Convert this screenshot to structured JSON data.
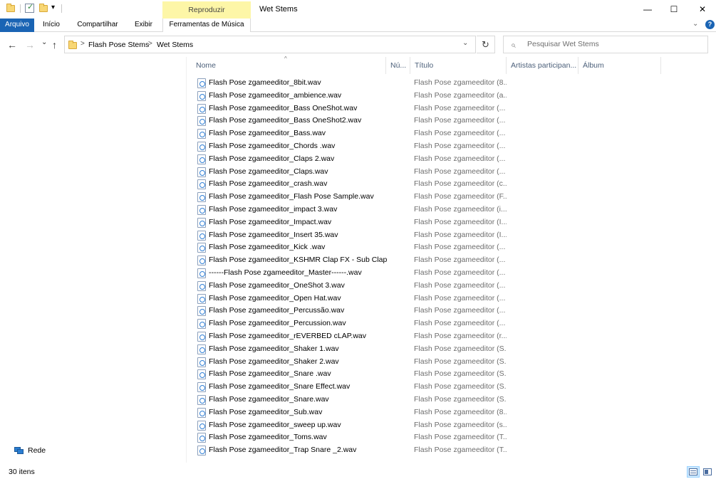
{
  "window": {
    "title": "Wet Stems",
    "minimize_glyph": "—",
    "maximize_glyph": "☐",
    "close_glyph": "✕"
  },
  "quick_access": {
    "dropdown_glyph": "▾"
  },
  "ribbon": {
    "context_group": "Reproduzir",
    "tabs": [
      {
        "label": "Arquivo"
      },
      {
        "label": "Início"
      },
      {
        "label": "Compartilhar"
      },
      {
        "label": "Exibir"
      },
      {
        "label": "Ferramentas de Música"
      }
    ],
    "expand_glyph": "⌄",
    "help_glyph": "?"
  },
  "navigation": {
    "back_glyph": "←",
    "forward_glyph": "→",
    "recent_glyph": "⌄",
    "up_glyph": "↑",
    "breadcrumb": [
      "Flash Pose Stems",
      "Wet Stems"
    ],
    "crumb_sep": ">",
    "address_dropdown_glyph": "⌄",
    "refresh_glyph": "↻"
  },
  "search": {
    "placeholder": "Pesquisar Wet Stems",
    "icon_glyph": "⌕"
  },
  "navpane": {
    "network_label": "Rede"
  },
  "columns": {
    "sort_glyph": "^",
    "headers": [
      "Nome",
      "Nú...",
      "Título",
      "Artistas participan...",
      "Álbum"
    ]
  },
  "files": [
    {
      "name": "Flash Pose zgameeditor_8bit.wav",
      "title": "Flash Pose zgameeditor (8..."
    },
    {
      "name": "Flash Pose zgameeditor_ambience.wav",
      "title": "Flash Pose zgameeditor (a..."
    },
    {
      "name": "Flash Pose zgameeditor_Bass OneShot.wav",
      "title": "Flash Pose zgameeditor (..."
    },
    {
      "name": "Flash Pose zgameeditor_Bass OneShot2.wav",
      "title": "Flash Pose zgameeditor (..."
    },
    {
      "name": "Flash Pose zgameeditor_Bass.wav",
      "title": "Flash Pose zgameeditor (..."
    },
    {
      "name": "Flash Pose zgameeditor_Chords .wav",
      "title": "Flash Pose zgameeditor (..."
    },
    {
      "name": "Flash Pose zgameeditor_Claps 2.wav",
      "title": "Flash Pose zgameeditor (..."
    },
    {
      "name": "Flash Pose zgameeditor_Claps.wav",
      "title": "Flash Pose zgameeditor (..."
    },
    {
      "name": "Flash Pose zgameeditor_crash.wav",
      "title": "Flash Pose zgameeditor (c..."
    },
    {
      "name": "Flash Pose zgameeditor_Flash Pose Sample.wav",
      "title": "Flash Pose zgameeditor (F..."
    },
    {
      "name": "Flash Pose zgameeditor_impact 3.wav",
      "title": "Flash Pose zgameeditor (i..."
    },
    {
      "name": "Flash Pose zgameeditor_Impact.wav",
      "title": "Flash Pose zgameeditor (I..."
    },
    {
      "name": "Flash Pose zgameeditor_Insert 35.wav",
      "title": "Flash Pose zgameeditor (I..."
    },
    {
      "name": "Flash Pose zgameeditor_Kick .wav",
      "title": "Flash Pose zgameeditor (..."
    },
    {
      "name": "Flash Pose zgameeditor_KSHMR Clap FX - Sub Clap ...",
      "title": "Flash Pose zgameeditor (..."
    },
    {
      "name": "------Flash Pose zgameeditor_Master------.wav",
      "title": "Flash Pose zgameeditor (..."
    },
    {
      "name": "Flash Pose zgameeditor_OneShot 3.wav",
      "title": "Flash Pose zgameeditor (..."
    },
    {
      "name": "Flash Pose zgameeditor_Open Hat.wav",
      "title": "Flash Pose zgameeditor (..."
    },
    {
      "name": "Flash Pose zgameeditor_Percussão.wav",
      "title": "Flash Pose zgameeditor (..."
    },
    {
      "name": "Flash Pose zgameeditor_Percussion.wav",
      "title": "Flash Pose zgameeditor (..."
    },
    {
      "name": "Flash Pose zgameeditor_rEVERBED cLAP.wav",
      "title": "Flash Pose zgameeditor (r..."
    },
    {
      "name": "Flash Pose zgameeditor_Shaker 1.wav",
      "title": "Flash Pose zgameeditor (S..."
    },
    {
      "name": "Flash Pose zgameeditor_Shaker 2.wav",
      "title": "Flash Pose zgameeditor (S..."
    },
    {
      "name": "Flash Pose zgameeditor_Snare .wav",
      "title": "Flash Pose zgameeditor (S..."
    },
    {
      "name": "Flash Pose zgameeditor_Snare Effect.wav",
      "title": "Flash Pose zgameeditor (S..."
    },
    {
      "name": "Flash Pose zgameeditor_Snare.wav",
      "title": "Flash Pose zgameeditor (S..."
    },
    {
      "name": "Flash Pose zgameeditor_Sub.wav",
      "title": "Flash Pose zgameeditor (8..."
    },
    {
      "name": "Flash Pose zgameeditor_sweep up.wav",
      "title": "Flash Pose zgameeditor (s..."
    },
    {
      "name": "Flash Pose zgameeditor_Toms.wav",
      "title": "Flash Pose zgameeditor (T..."
    },
    {
      "name": "Flash Pose zgameeditor_Trap Snare _2.wav",
      "title": "Flash Pose zgameeditor (T..."
    }
  ],
  "status": {
    "count": "30 itens"
  },
  "colors": {
    "file_tab": "#1a64b4",
    "context_tab": "#fdf6a7",
    "column_header_text": "#4c607a",
    "secondary_text": "#6d6d6d"
  }
}
